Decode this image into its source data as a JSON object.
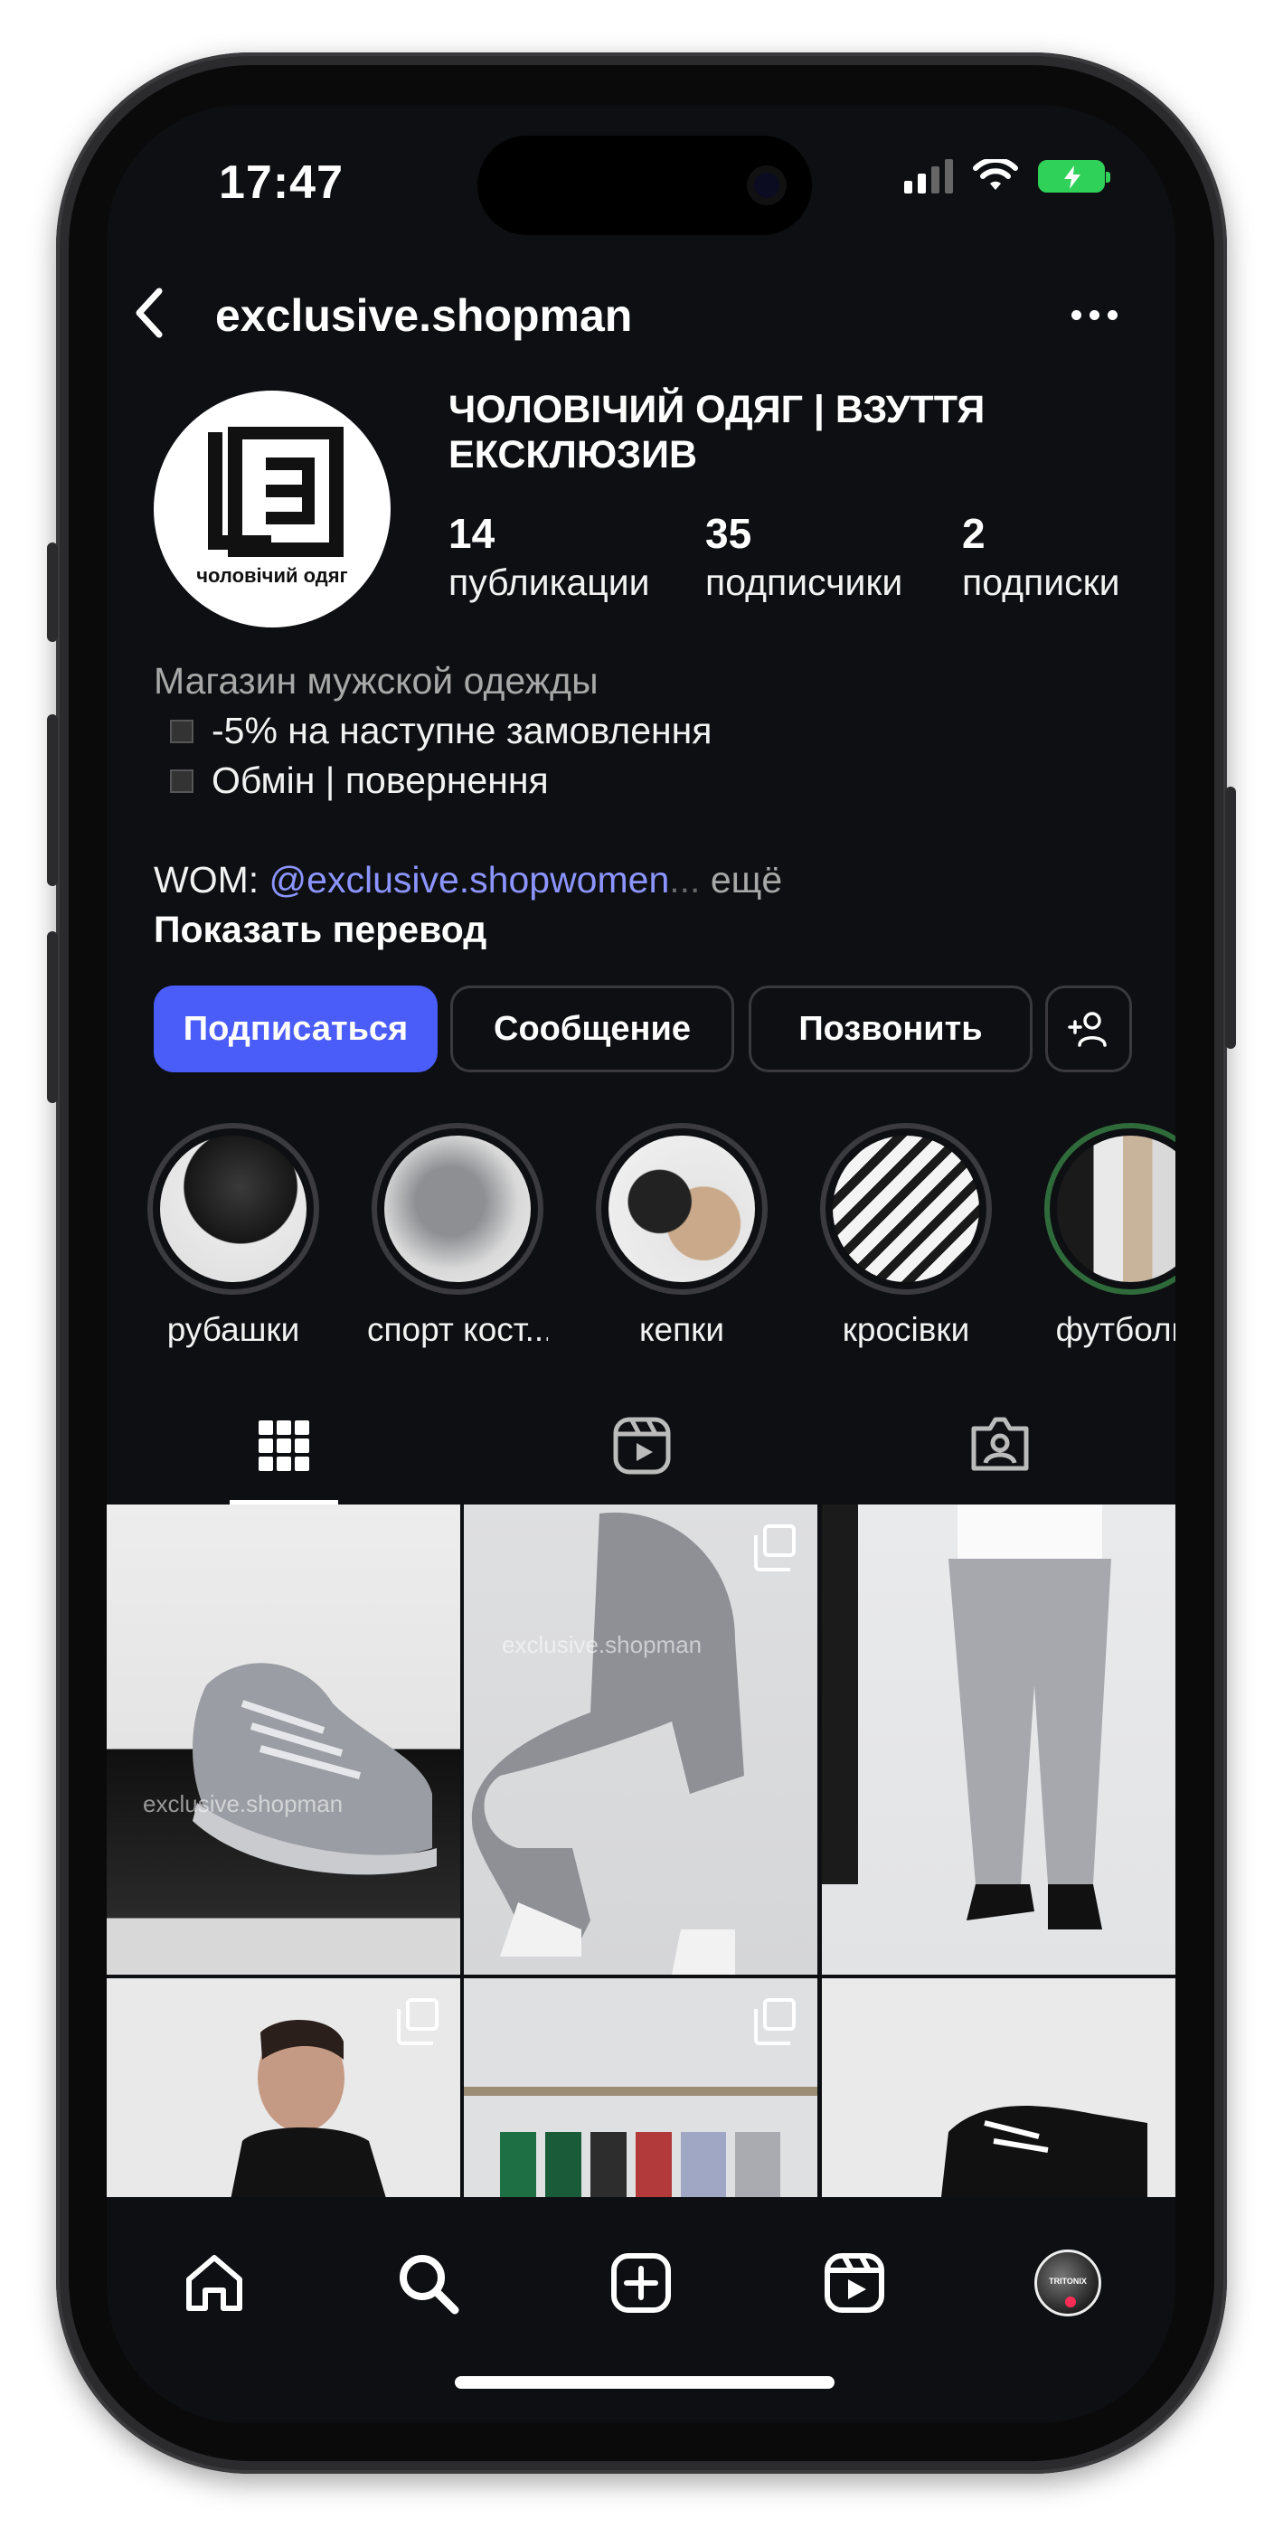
{
  "status_bar": {
    "time": "17:47"
  },
  "header": {
    "username": "exclusive.shopman"
  },
  "profile": {
    "display_name": "ЧОЛОВІЧИЙ ОДЯГ | ВЗУТТЯ ЕКСКЛЮЗИВ",
    "avatar_text": "чоловічий одяг",
    "stats": [
      {
        "value": "14",
        "label": "публикации"
      },
      {
        "value": "35",
        "label": "подписчики"
      },
      {
        "value": "2",
        "label": "подписки"
      }
    ],
    "bio": {
      "category": "Магазин мужской одежды",
      "lines": [
        "-5% на наступне замовлення",
        "Обмін | повернення"
      ],
      "wom_prefix": "WOM: ",
      "wom_link": "@exclusive.shopwomen",
      "ellipsis": "...",
      "more": " ещё",
      "translate": "Показать перевод"
    }
  },
  "buttons": {
    "follow": "Подписаться",
    "message": "Сообщение",
    "call": "Позвонить"
  },
  "highlights": [
    {
      "label": "рубашки"
    },
    {
      "label": "спорт кост..."
    },
    {
      "label": "кепки"
    },
    {
      "label": "кросівки"
    },
    {
      "label": "футболки"
    }
  ],
  "grid": {
    "watermark": "exclusive.shopman"
  },
  "nav_avatar_text": "TRITONIX",
  "colors": {
    "accent": "#4a5df9",
    "link": "#8c95ff",
    "background": "#0e0f13",
    "battery": "#30d158",
    "badge": "#ff2d55"
  },
  "icons": {
    "tabs": [
      "grid-icon",
      "reels-icon",
      "tagged-icon"
    ],
    "nav": [
      "home-icon",
      "search-icon",
      "create-icon",
      "reels-icon",
      "profile-avatar"
    ]
  }
}
